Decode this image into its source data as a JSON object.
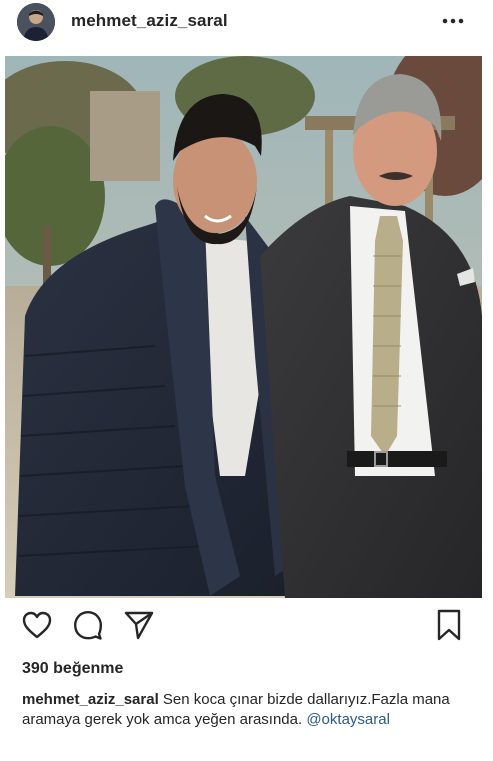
{
  "header": {
    "username": "mehmet_aziz_saral",
    "more_icon": "ellipsis-horizontal-icon"
  },
  "post": {
    "image_description_icon": "photo",
    "likes_text": "390 beğenme",
    "caption": {
      "username": "mehmet_aziz_saral",
      "text": "Sen koca çınar bizde dallarıyız.Fazla mana aramaya gerek yok amca yeğen arasında.",
      "mention": "@oktaysaral"
    }
  },
  "actions": {
    "like_icon": "heart-icon",
    "comment_icon": "comment-icon",
    "share_icon": "share-icon",
    "save_icon": "bookmark-icon"
  }
}
